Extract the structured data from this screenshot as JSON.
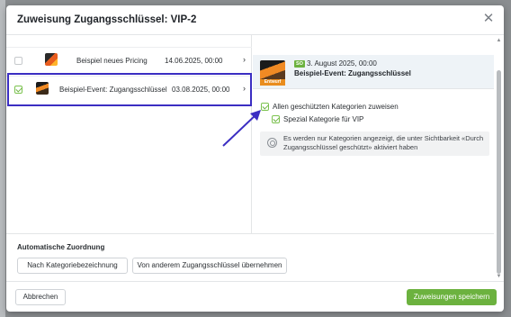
{
  "modal": {
    "title": "Zuweisung Zugangsschlüssel: VIP-2",
    "close_icon": "close-icon"
  },
  "events": [
    {
      "name": "Beispiel neues Pricing",
      "date": "14.06.2025, 00:00",
      "checked": false
    },
    {
      "name": "Beispiel-Event: Zugangsschlüssel",
      "date": "03.08.2025, 00:00",
      "checked": true
    }
  ],
  "detail": {
    "badge": "SO",
    "draft_label": "Entwurf",
    "date": "3. August 2025, 00:00",
    "name": "Beispiel-Event: Zugangsschlüssel",
    "all_categories_label": "Allen geschützten Kategorien zuweisen",
    "category_label": "Spezial Kategorie für VIP",
    "info_text": "Es werden nur Kategorien angezeigt, die unter Sichtbarkeit «Durch Zugangsschlüssel geschützt» aktiviert haben"
  },
  "auto": {
    "title": "Automatische Zuordnung",
    "by_category_label": "Nach Kategoriebezeichnung",
    "from_other_key_label": "Von anderem Zugangsschlüssel übernehmen"
  },
  "footer": {
    "cancel_label": "Abbrechen",
    "save_label": "Zuweisungen speichern"
  },
  "colors": {
    "accent_green": "#6cb23f",
    "highlight_border": "#3b2ec2",
    "draft_orange": "#e98d1e"
  }
}
